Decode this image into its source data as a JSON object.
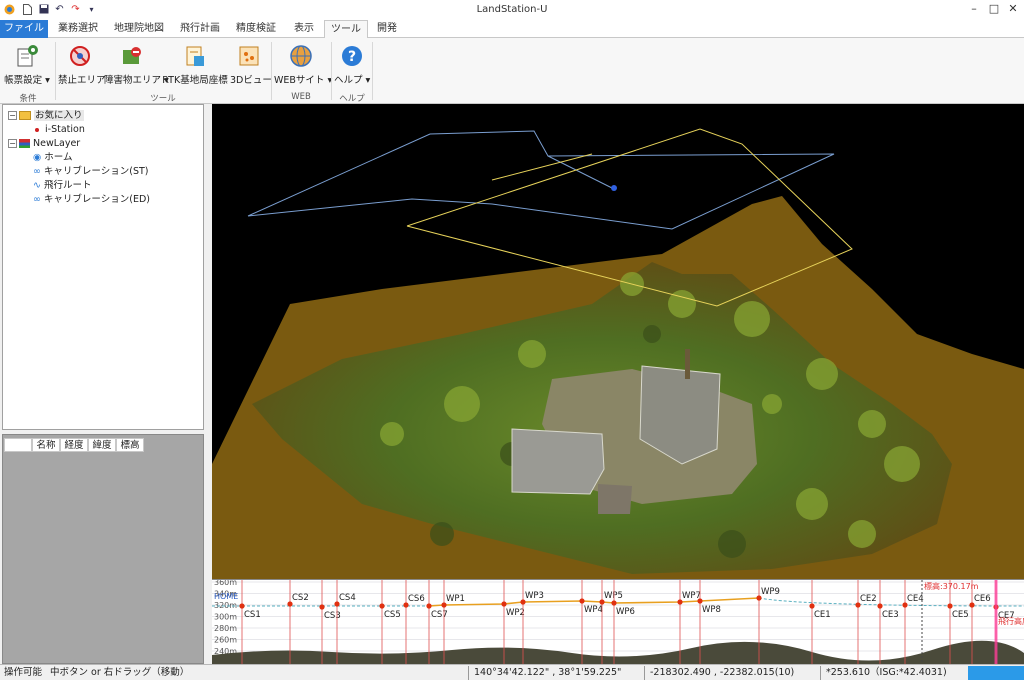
{
  "window": {
    "title": "LandStation-U"
  },
  "tabs": [
    "ファイル",
    "業務選択",
    "地理院地図",
    "飛行計画",
    "精度検証",
    "表示",
    "ツール",
    "開発"
  ],
  "ribbon": {
    "buttons": {
      "report_settings": "帳票設定",
      "no_fly_area": "禁止エリア",
      "obstacle_area": "障害物エリア",
      "rtk_base": "RTK基地局座標",
      "view3d": "3Dビュー",
      "web_site": "WEBサイト",
      "help": "ヘルプ"
    },
    "groups": {
      "condition": "条件",
      "tools": "ツール",
      "web": "WEB",
      "help": "ヘルプ"
    }
  },
  "tree": {
    "favorites": "お気に入り",
    "istation": "i-Station",
    "layer": "NewLayer",
    "home": "ホーム",
    "calib_start": "キャリブレーション(ST)",
    "flight_route": "飛行ルート",
    "calib_end": "キャリブレーション(ED)"
  },
  "table": {
    "headers": [
      "名称",
      "経度",
      "緯度",
      "標高"
    ]
  },
  "profile": {
    "y_ticks": [
      "360m",
      "340m",
      "320m",
      "300m",
      "280m",
      "260m",
      "240m"
    ],
    "home_label": "HOME",
    "altitude_label": "標高:370.17m",
    "markers": [
      "CS1",
      "CS2",
      "CS3",
      "CS4",
      "CS5",
      "CS6",
      "CS7",
      "WP1",
      "WP2",
      "WP3",
      "WP4",
      "WP5",
      "WP6",
      "WP7",
      "WP8",
      "WP9",
      "CE1",
      "CE2",
      "CE3",
      "CE4",
      "CE5",
      "CE6",
      "CE7"
    ],
    "overlay_text": "飛行高度"
  },
  "status": {
    "state": "操作可能",
    "hint": "中ボタン or 右ドラッグ（移動）",
    "latlon": "140°34'42.122\" , 38°1'59.225\"",
    "xy": "-218302.490 , -22382.015(10)",
    "elev": "*253.610（ISG:*42.4031)"
  },
  "colors": {
    "accent": "#2b7bd6",
    "ground": "#7a5a10",
    "route": "#e8a020",
    "marker": "#e03010"
  }
}
